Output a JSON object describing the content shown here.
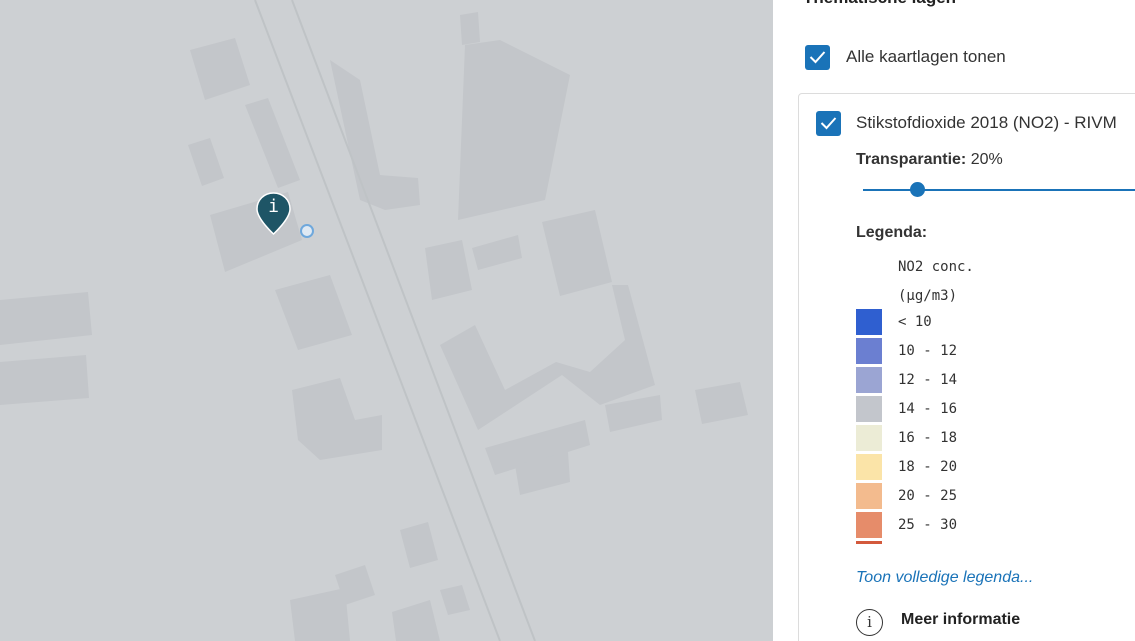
{
  "panel": {
    "title": "Thematische lagen",
    "show_all_label": "Alle kaartlagen tonen",
    "layer": {
      "name": "Stikstofdioxide 2018 (NO2) - RIVM",
      "transparency_label": "Transparantie:",
      "transparency_value": "20%",
      "transparency_fraction": 0.2,
      "legend_title": "Legenda:",
      "legend_header_1": "NO2 conc.",
      "legend_header_2": "(µg/m3)",
      "legend_items": [
        {
          "label": "< 10",
          "color": "#2f5fd0"
        },
        {
          "label": "10 - 12",
          "color": "#6b7fd1"
        },
        {
          "label": "12 - 14",
          "color": "#9ba5d3"
        },
        {
          "label": "14 - 16",
          "color": "#c3c6cc"
        },
        {
          "label": "16 - 18",
          "color": "#ececd6"
        },
        {
          "label": "18 - 20",
          "color": "#fbe4a8"
        },
        {
          "label": "20 - 25",
          "color": "#f3bb8e"
        },
        {
          "label": "25 - 30",
          "color": "#e68c6a"
        },
        {
          "label": "",
          "color": "#d3593c"
        }
      ],
      "full_legend_link": "Toon volledige legenda...",
      "more_info": "Meer informatie"
    }
  },
  "map": {
    "marker_glyph": "i",
    "marker_color": "#1e5566",
    "accent": "#1a73b8"
  }
}
